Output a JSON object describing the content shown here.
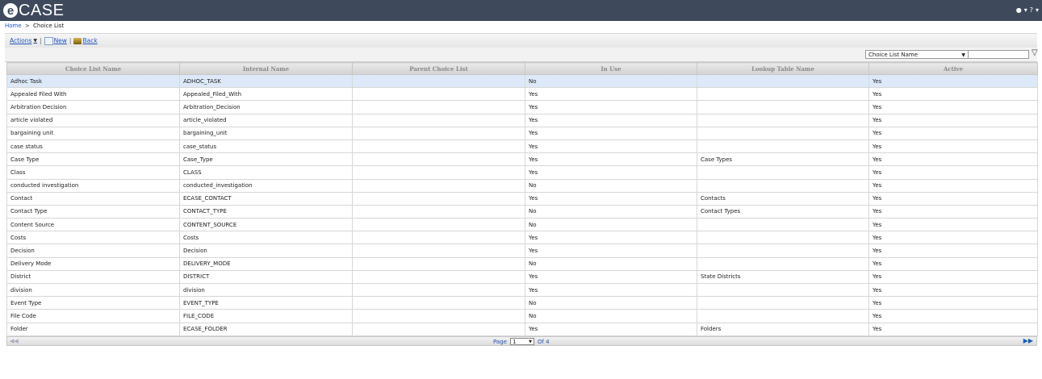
{
  "app": {
    "logo_letter": "e",
    "logo_text": "CASE"
  },
  "topbar": {
    "user_icon": "user-icon",
    "help_label": "?"
  },
  "breadcrumb": {
    "home": "Home",
    "separator": ">",
    "current": "Choice List"
  },
  "toolbar": {
    "actions": "Actions",
    "new": "New",
    "back": "Back"
  },
  "filter": {
    "field_selected": "Choice List Name",
    "value": ""
  },
  "table": {
    "columns": [
      "Choice List Name",
      "Internal Name",
      "Parent Choice List",
      "In Use",
      "Lookup Table Name",
      "Active"
    ],
    "rows": [
      [
        "Adhoc Task",
        "ADHOC_TASK",
        "",
        "No",
        "",
        "Yes"
      ],
      [
        "Appealed Filed With",
        "Appealed_Filed_With",
        "",
        "Yes",
        "",
        "Yes"
      ],
      [
        "Arbitration Decision",
        "Arbitration_Decision",
        "",
        "Yes",
        "",
        "Yes"
      ],
      [
        "article violated",
        "article_violated",
        "",
        "Yes",
        "",
        "Yes"
      ],
      [
        "bargaining unit",
        "bargaining_unit",
        "",
        "Yes",
        "",
        "Yes"
      ],
      [
        "case status",
        "case_status",
        "",
        "Yes",
        "",
        "Yes"
      ],
      [
        "Case Type",
        "Case_Type",
        "",
        "Yes",
        "Case Types",
        "Yes"
      ],
      [
        "Class",
        "CLASS",
        "",
        "Yes",
        "",
        "Yes"
      ],
      [
        "conducted investigation",
        "conducted_investigation",
        "",
        "No",
        "",
        "Yes"
      ],
      [
        "Contact",
        "ECASE_CONTACT",
        "",
        "Yes",
        "Contacts",
        "Yes"
      ],
      [
        "Contact Type",
        "CONTACT_TYPE",
        "",
        "No",
        "Contact Types",
        "Yes"
      ],
      [
        "Content Source",
        "CONTENT_SOURCE",
        "",
        "No",
        "",
        "Yes"
      ],
      [
        "Costs",
        "Costs",
        "",
        "Yes",
        "",
        "Yes"
      ],
      [
        "Decision",
        "Decision",
        "",
        "Yes",
        "",
        "Yes"
      ],
      [
        "Delivery Mode",
        "DELIVERY_MODE",
        "",
        "No",
        "",
        "Yes"
      ],
      [
        "District",
        "DISTRICT",
        "",
        "Yes",
        "State Districts",
        "Yes"
      ],
      [
        "division",
        "division",
        "",
        "Yes",
        "",
        "Yes"
      ],
      [
        "Event Type",
        "EVENT_TYPE",
        "",
        "No",
        "",
        "Yes"
      ],
      [
        "File Code",
        "FILE_CODE",
        "",
        "No",
        "",
        "Yes"
      ],
      [
        "Folder",
        "ECASE_FOLDER",
        "",
        "Yes",
        "Folders",
        "Yes"
      ]
    ]
  },
  "pager": {
    "page_label": "Page",
    "page_value": "1",
    "of_label": "Of 4"
  },
  "colors": {
    "header_bg": "#3e4a5c",
    "link": "#2255bb",
    "selected_row": "#dde9f8"
  }
}
